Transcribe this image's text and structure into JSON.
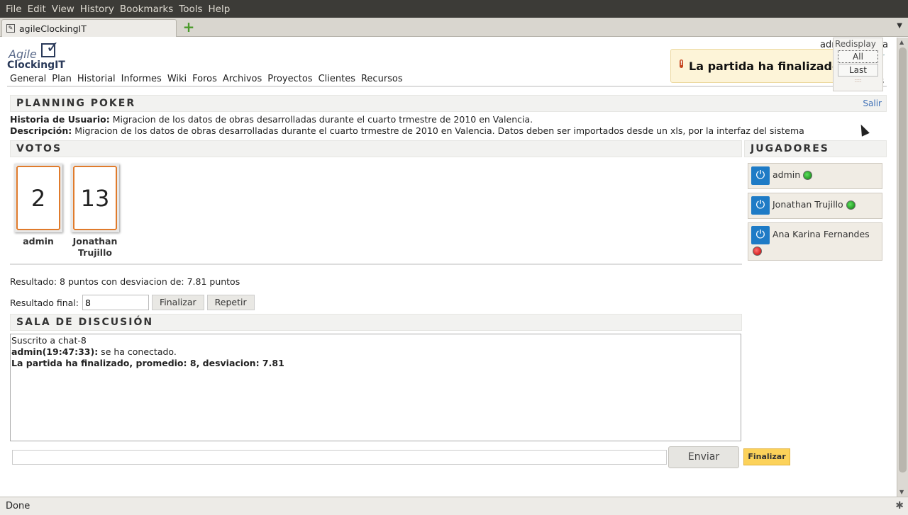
{
  "browser": {
    "menu": [
      "File",
      "Edit",
      "View",
      "History",
      "Bookmarks",
      "Tools",
      "Help"
    ],
    "tab_title": "agileClockingIT",
    "status": "Done"
  },
  "header": {
    "logo_line1": "Agile",
    "logo_line2": "ClockingIT",
    "user_partial": "adm",
    "user_tail": "a",
    "user_tail2": "r",
    "nav_tail": "s"
  },
  "nav": [
    "General",
    "Plan",
    "Historial",
    "Informes",
    "Wiki",
    "Foros",
    "Archivos",
    "Proyectos",
    "Clientes",
    "Recursos"
  ],
  "notice": {
    "icon": "alert-icon",
    "text": "La partida ha finalizado"
  },
  "redisplay": {
    "title": "Redisplay",
    "all": "All",
    "last": "Last",
    "grip": "::::"
  },
  "planning": {
    "title": "PLANNING POKER",
    "exit": "Salir",
    "story_label": "Historia de Usuario:",
    "story_text": " Migracion de los datos de obras desarrolladas durante el cuarto trmestre de 2010 en Valencia.",
    "desc_label": "Descripción:",
    "desc_text": " Migracion de los datos de obras desarrolladas durante el cuarto trmestre de 2010 en Valencia. Datos deben ser importados desde un xls, por la interfaz del sistema"
  },
  "votes": {
    "title": "VOTOS",
    "cards": [
      {
        "value": "2",
        "name": "admin"
      },
      {
        "value": "13",
        "name": "Jonathan Trujillo"
      }
    ]
  },
  "players": {
    "title": "JUGADORES",
    "list": [
      {
        "name": "admin",
        "status": "online"
      },
      {
        "name": "Jonathan Trujillo",
        "status": "online"
      },
      {
        "name": "Ana Karina Fernandes",
        "status": "offline"
      }
    ]
  },
  "result": {
    "text": "Resultado: 8 puntos con desviacion de: 7.81 puntos",
    "final_label": "Resultado final:",
    "final_value": "8",
    "finalize": "Finalizar",
    "repeat": "Repetir"
  },
  "chat": {
    "title": "SALA DE DISCUSIÓN",
    "line1": "Suscrito a chat-8",
    "line2_user": "admin(19:47:33):",
    "line2_text": " se ha conectado.",
    "line3": "La partida ha finalizado, promedio: 8, desviacion: 7.81",
    "send": "Enviar",
    "finalize": "Finalizar"
  }
}
